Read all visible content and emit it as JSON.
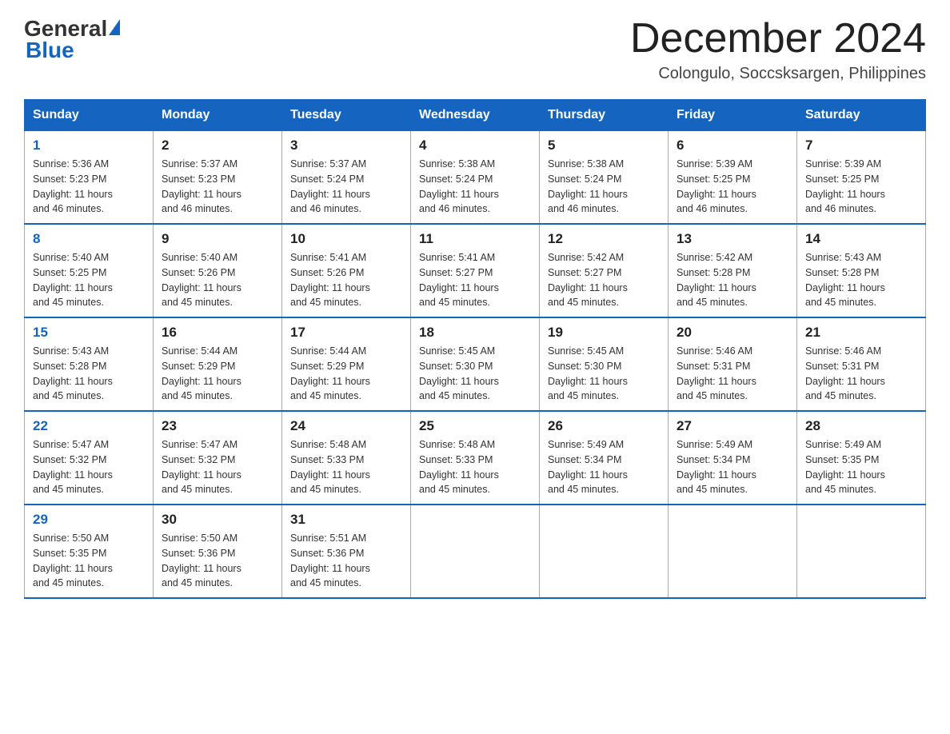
{
  "logo": {
    "general": "General",
    "blue": "Blue"
  },
  "header": {
    "month_title": "December 2024",
    "location": "Colongulo, Soccsksargen, Philippines"
  },
  "days_of_week": [
    "Sunday",
    "Monday",
    "Tuesday",
    "Wednesday",
    "Thursday",
    "Friday",
    "Saturday"
  ],
  "weeks": [
    [
      {
        "day": "1",
        "sunrise": "5:36 AM",
        "sunset": "5:23 PM",
        "daylight": "11 hours and 46 minutes."
      },
      {
        "day": "2",
        "sunrise": "5:37 AM",
        "sunset": "5:23 PM",
        "daylight": "11 hours and 46 minutes."
      },
      {
        "day": "3",
        "sunrise": "5:37 AM",
        "sunset": "5:24 PM",
        "daylight": "11 hours and 46 minutes."
      },
      {
        "day": "4",
        "sunrise": "5:38 AM",
        "sunset": "5:24 PM",
        "daylight": "11 hours and 46 minutes."
      },
      {
        "day": "5",
        "sunrise": "5:38 AM",
        "sunset": "5:24 PM",
        "daylight": "11 hours and 46 minutes."
      },
      {
        "day": "6",
        "sunrise": "5:39 AM",
        "sunset": "5:25 PM",
        "daylight": "11 hours and 46 minutes."
      },
      {
        "day": "7",
        "sunrise": "5:39 AM",
        "sunset": "5:25 PM",
        "daylight": "11 hours and 46 minutes."
      }
    ],
    [
      {
        "day": "8",
        "sunrise": "5:40 AM",
        "sunset": "5:25 PM",
        "daylight": "11 hours and 45 minutes."
      },
      {
        "day": "9",
        "sunrise": "5:40 AM",
        "sunset": "5:26 PM",
        "daylight": "11 hours and 45 minutes."
      },
      {
        "day": "10",
        "sunrise": "5:41 AM",
        "sunset": "5:26 PM",
        "daylight": "11 hours and 45 minutes."
      },
      {
        "day": "11",
        "sunrise": "5:41 AM",
        "sunset": "5:27 PM",
        "daylight": "11 hours and 45 minutes."
      },
      {
        "day": "12",
        "sunrise": "5:42 AM",
        "sunset": "5:27 PM",
        "daylight": "11 hours and 45 minutes."
      },
      {
        "day": "13",
        "sunrise": "5:42 AM",
        "sunset": "5:28 PM",
        "daylight": "11 hours and 45 minutes."
      },
      {
        "day": "14",
        "sunrise": "5:43 AM",
        "sunset": "5:28 PM",
        "daylight": "11 hours and 45 minutes."
      }
    ],
    [
      {
        "day": "15",
        "sunrise": "5:43 AM",
        "sunset": "5:28 PM",
        "daylight": "11 hours and 45 minutes."
      },
      {
        "day": "16",
        "sunrise": "5:44 AM",
        "sunset": "5:29 PM",
        "daylight": "11 hours and 45 minutes."
      },
      {
        "day": "17",
        "sunrise": "5:44 AM",
        "sunset": "5:29 PM",
        "daylight": "11 hours and 45 minutes."
      },
      {
        "day": "18",
        "sunrise": "5:45 AM",
        "sunset": "5:30 PM",
        "daylight": "11 hours and 45 minutes."
      },
      {
        "day": "19",
        "sunrise": "5:45 AM",
        "sunset": "5:30 PM",
        "daylight": "11 hours and 45 minutes."
      },
      {
        "day": "20",
        "sunrise": "5:46 AM",
        "sunset": "5:31 PM",
        "daylight": "11 hours and 45 minutes."
      },
      {
        "day": "21",
        "sunrise": "5:46 AM",
        "sunset": "5:31 PM",
        "daylight": "11 hours and 45 minutes."
      }
    ],
    [
      {
        "day": "22",
        "sunrise": "5:47 AM",
        "sunset": "5:32 PM",
        "daylight": "11 hours and 45 minutes."
      },
      {
        "day": "23",
        "sunrise": "5:47 AM",
        "sunset": "5:32 PM",
        "daylight": "11 hours and 45 minutes."
      },
      {
        "day": "24",
        "sunrise": "5:48 AM",
        "sunset": "5:33 PM",
        "daylight": "11 hours and 45 minutes."
      },
      {
        "day": "25",
        "sunrise": "5:48 AM",
        "sunset": "5:33 PM",
        "daylight": "11 hours and 45 minutes."
      },
      {
        "day": "26",
        "sunrise": "5:49 AM",
        "sunset": "5:34 PM",
        "daylight": "11 hours and 45 minutes."
      },
      {
        "day": "27",
        "sunrise": "5:49 AM",
        "sunset": "5:34 PM",
        "daylight": "11 hours and 45 minutes."
      },
      {
        "day": "28",
        "sunrise": "5:49 AM",
        "sunset": "5:35 PM",
        "daylight": "11 hours and 45 minutes."
      }
    ],
    [
      {
        "day": "29",
        "sunrise": "5:50 AM",
        "sunset": "5:35 PM",
        "daylight": "11 hours and 45 minutes."
      },
      {
        "day": "30",
        "sunrise": "5:50 AM",
        "sunset": "5:36 PM",
        "daylight": "11 hours and 45 minutes."
      },
      {
        "day": "31",
        "sunrise": "5:51 AM",
        "sunset": "5:36 PM",
        "daylight": "11 hours and 45 minutes."
      },
      null,
      null,
      null,
      null
    ]
  ],
  "labels": {
    "sunrise": "Sunrise:",
    "sunset": "Sunset:",
    "daylight": "Daylight:"
  }
}
